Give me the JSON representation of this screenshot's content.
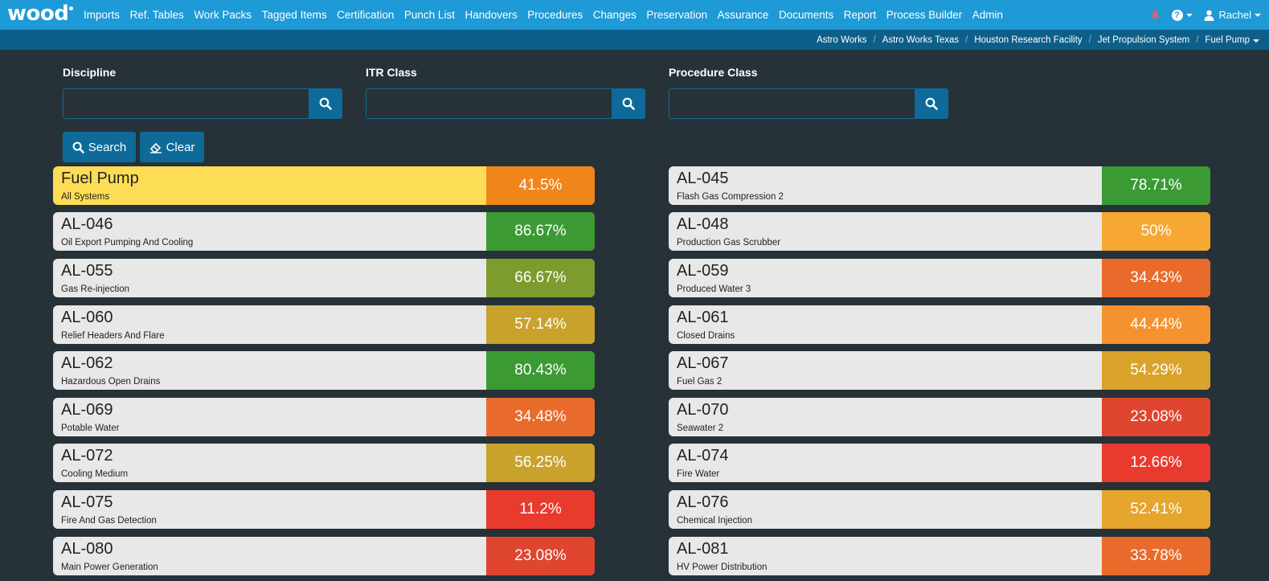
{
  "brand": {
    "logo_text": "wood"
  },
  "nav": {
    "items": [
      "Imports",
      "Ref. Tables",
      "Work Packs",
      "Tagged Items",
      "Certification",
      "Punch List",
      "Handovers",
      "Procedures",
      "Changes",
      "Preservation",
      "Assurance",
      "Documents",
      "Report",
      "Process Builder",
      "Admin"
    ],
    "user_name": "Rachel"
  },
  "breadcrumb": [
    "Astro Works",
    "Astro Works Texas",
    "Houston Research Facility",
    "Jet Propulsion System",
    "Fuel Pump"
  ],
  "filters": {
    "discipline": {
      "label": "Discipline",
      "value": ""
    },
    "itr_class": {
      "label": "ITR Class",
      "value": ""
    },
    "procedure_class": {
      "label": "Procedure Class",
      "value": ""
    }
  },
  "actions": {
    "search_label": "Search",
    "clear_label": "Clear"
  },
  "colors": {
    "nav": "#1e9ad6",
    "breadcrumb_bar": "#0d5f8a",
    "background": "#263238",
    "button": "#0e6a99",
    "highlight_card": "#fedd56"
  },
  "cards_left": [
    {
      "code": "Fuel Pump",
      "desc": "All Systems",
      "pct": "41.5%",
      "color": "#f0851c",
      "highlight": true
    },
    {
      "code": "AL-046",
      "desc": "Oil Export Pumping And Cooling",
      "pct": "86.67%",
      "color": "#3c9a34"
    },
    {
      "code": "AL-055",
      "desc": "Gas Re-injection",
      "pct": "66.67%",
      "color": "#7e9b2e"
    },
    {
      "code": "AL-060",
      "desc": "Relief Headers And Flare",
      "pct": "57.14%",
      "color": "#c9a22c"
    },
    {
      "code": "AL-062",
      "desc": "Hazardous Open Drains",
      "pct": "80.43%",
      "color": "#3c9a34"
    },
    {
      "code": "AL-069",
      "desc": "Potable Water",
      "pct": "34.48%",
      "color": "#e96b2c"
    },
    {
      "code": "AL-072",
      "desc": "Cooling Medium",
      "pct": "56.25%",
      "color": "#c9a22c"
    },
    {
      "code": "AL-075",
      "desc": "Fire And Gas Detection",
      "pct": "11.2%",
      "color": "#e83a2d"
    },
    {
      "code": "AL-080",
      "desc": "Main Power Generation",
      "pct": "23.08%",
      "color": "#e0452f"
    }
  ],
  "cards_right": [
    {
      "code": "AL-045",
      "desc": "Flash Gas Compression 2",
      "pct": "78.71%",
      "color": "#3c9a34"
    },
    {
      "code": "AL-048",
      "desc": "Production Gas Scrubber",
      "pct": "50%",
      "color": "#f6a832"
    },
    {
      "code": "AL-059",
      "desc": "Produced Water 3",
      "pct": "34.43%",
      "color": "#e96b2c"
    },
    {
      "code": "AL-061",
      "desc": "Closed Drains",
      "pct": "44.44%",
      "color": "#f4922f"
    },
    {
      "code": "AL-067",
      "desc": "Fuel Gas 2",
      "pct": "54.29%",
      "color": "#d9a32c"
    },
    {
      "code": "AL-070",
      "desc": "Seawater 2",
      "pct": "23.08%",
      "color": "#e0452f"
    },
    {
      "code": "AL-074",
      "desc": "Fire Water",
      "pct": "12.66%",
      "color": "#e83a2d"
    },
    {
      "code": "AL-076",
      "desc": "Chemical Injection",
      "pct": "52.41%",
      "color": "#e6a52d"
    },
    {
      "code": "AL-081",
      "desc": "HV Power Distribution",
      "pct": "33.78%",
      "color": "#e96b2c"
    }
  ]
}
